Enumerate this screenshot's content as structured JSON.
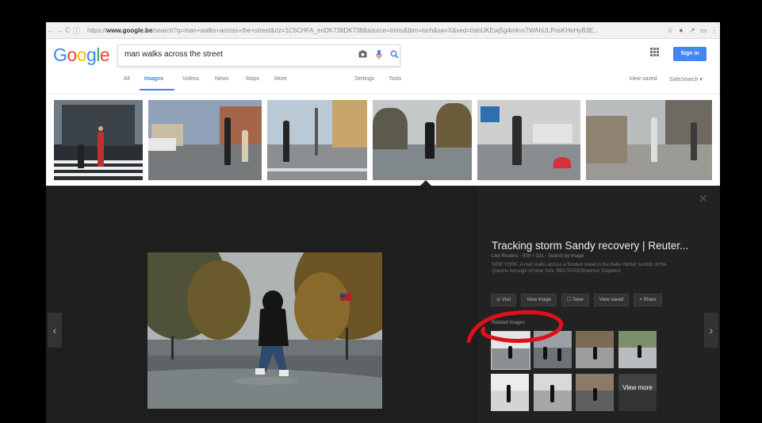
{
  "browser": {
    "nav_back": "←",
    "nav_forward": "→",
    "nav_reload": "C",
    "nav_info": "ⓘ",
    "url_prefix": "https://",
    "url_domain": "www.google.be",
    "url_rest": "/search?q=man+walks+across+the+street&rlz=1C5CHFA_enDK738DK738&source=lnms&tbm=isch&sa=X&ved=0ahUKEwj5g4mkvv7WAhULPosKHeHyB3E...",
    "icons": [
      "star-icon",
      "location-icon",
      "extension-icon",
      "cast-icon",
      "menu-icon"
    ]
  },
  "google": {
    "logo_letters": [
      "G",
      "o",
      "o",
      "g",
      "l",
      "e"
    ],
    "search_query": "man walks across the street",
    "apps_glyph": "⋮⋮⋮",
    "signin_label": "Sign in"
  },
  "tabs": {
    "items": [
      "All",
      "Images",
      "Videos",
      "News",
      "Maps",
      "More"
    ],
    "active": "Images",
    "settings": "Settings",
    "tools": "Tools",
    "view_saved": "View saved",
    "safesearch": "SafeSearch ▾"
  },
  "thumbnails": [
    {
      "label": "",
      "sky": "#6e7a84",
      "ground": "#2b2f33"
    },
    {
      "label": "",
      "sky": "#8fa2b8",
      "ground": "#777a7c"
    },
    {
      "label": "",
      "sky": "#b9c9d6",
      "ground": "#8b8f91"
    },
    {
      "label": "",
      "sky": "#c4c8c9",
      "ground": "#80888c"
    },
    {
      "label": "",
      "sky": "#cfcfcf",
      "ground": "#8a8d8f"
    },
    {
      "label": "",
      "sky": "#b9bcbd",
      "ground": "#9c9a94"
    }
  ],
  "panel": {
    "close_glyph": "✕",
    "prev_glyph": "‹",
    "next_glyph": "›",
    "title": "Tracking storm Sandy recovery | Reuter...",
    "meta": "Live Reuters - 500 × 331 - Search by image",
    "description": "NEW YORK: A man walks across a flooded street in the Belle Harbor section of the Queens borough of New York. REUTERS/Shannon Stapleton",
    "actions": [
      "Visit",
      "View image",
      "Save",
      "View saved",
      "Share"
    ],
    "related_label": "Related images",
    "view_more": "View more"
  },
  "colors": {
    "accent": "#4285f4",
    "panel_bg": "#222222",
    "annotation": "#e0101a"
  }
}
